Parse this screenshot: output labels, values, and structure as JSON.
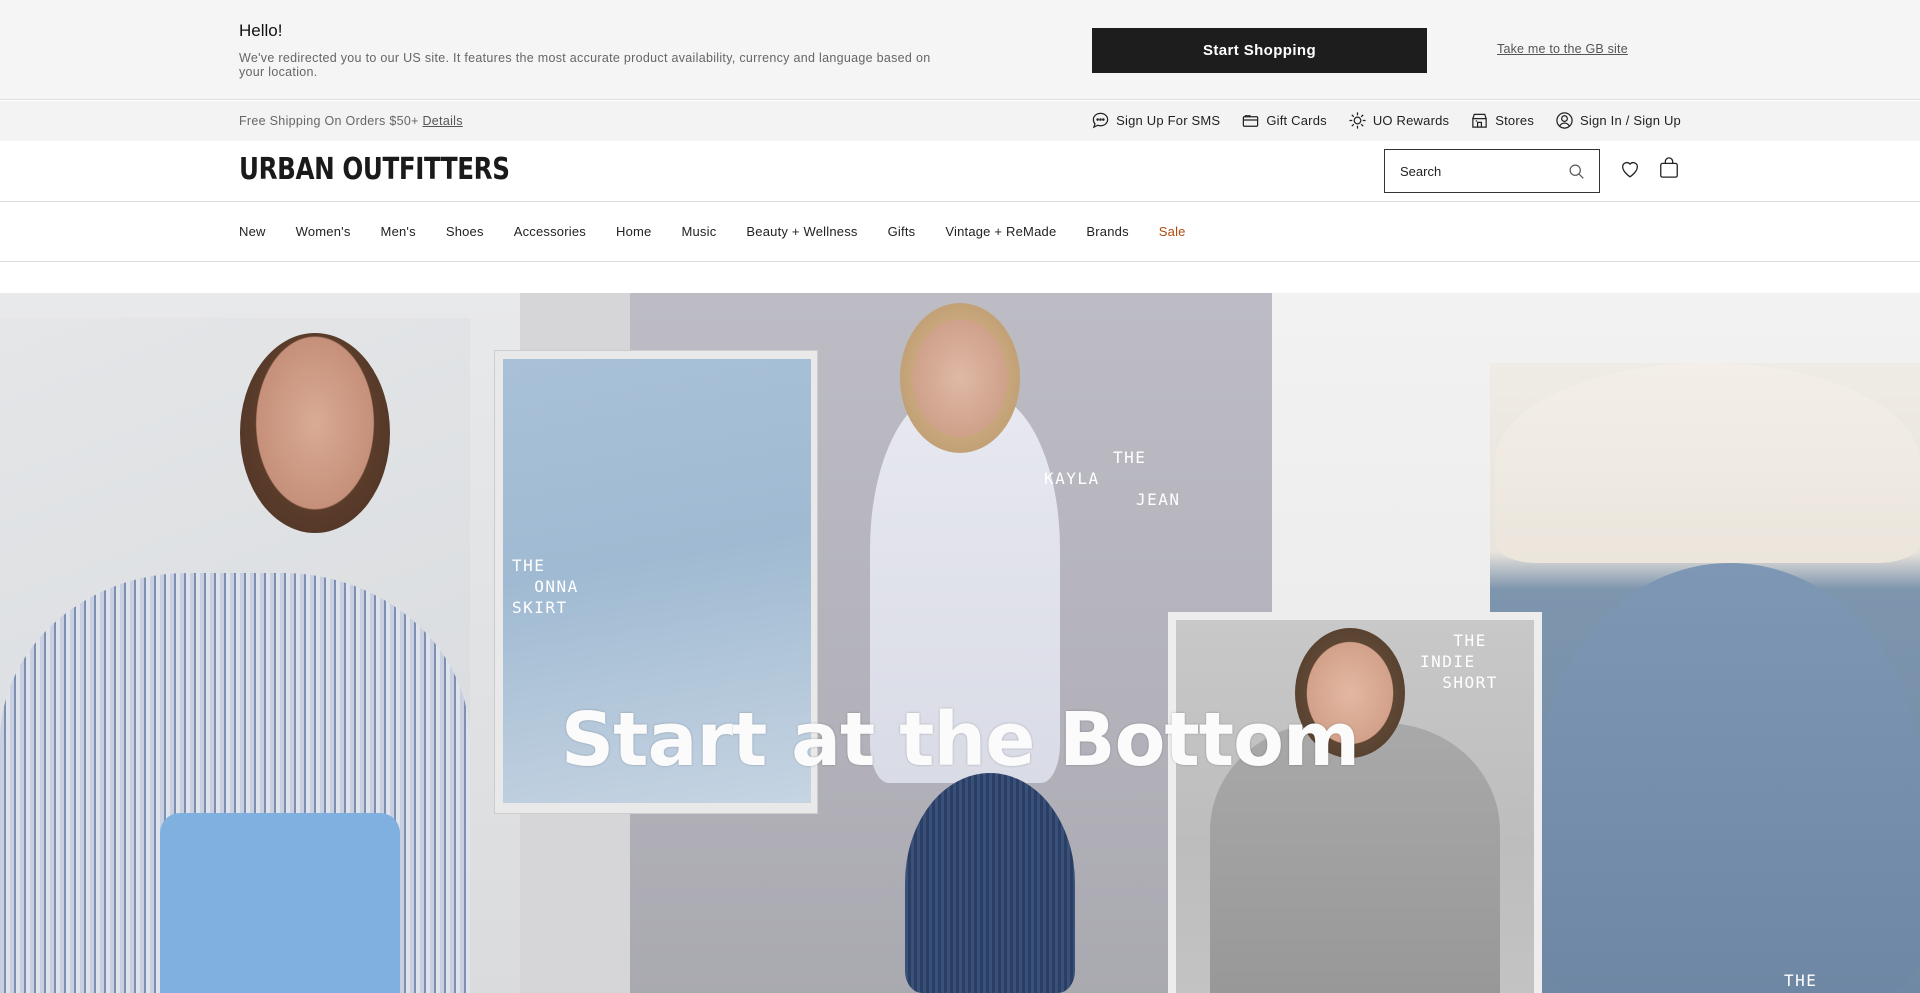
{
  "redirect_banner": {
    "greeting": "Hello!",
    "message": "We've redirected you to our US site. It features the most accurate product availability, currency and language based on your location.",
    "start_button": "Start Shopping",
    "gb_link": "Take me to the GB site"
  },
  "utility_bar": {
    "shipping_text": "Free Shipping On Orders $50+",
    "details_link": "Details",
    "links": [
      {
        "label": "Sign Up For SMS",
        "icon": "chat-bubble-icon"
      },
      {
        "label": "Gift Cards",
        "icon": "gift-card-icon"
      },
      {
        "label": "UO Rewards",
        "icon": "rewards-star-icon"
      },
      {
        "label": "Stores",
        "icon": "store-icon"
      },
      {
        "label": "Sign In / Sign Up",
        "icon": "user-icon"
      }
    ]
  },
  "header": {
    "logo": "URBAN OUTFITTERS",
    "search_placeholder": "Search"
  },
  "nav": {
    "items": [
      "New",
      "Women's",
      "Men's",
      "Shoes",
      "Accessories",
      "Home",
      "Music",
      "Beauty + Wellness",
      "Gifts",
      "Vintage + ReMade",
      "Brands",
      "Sale"
    ]
  },
  "hero": {
    "title": "Start at the Bottom",
    "labels": {
      "onna": "THE\n  ONNA\nSKIRT",
      "kayla_the": "THE",
      "kayla": "KAYLA",
      "kayla_jean": "JEAN",
      "indie": "   THE\nINDIE\n  SHORT",
      "bottom_the": "THE"
    }
  },
  "colors": {
    "primary_button": "#1d1d1d",
    "sale": "#b04a10",
    "banner_bg": "#f5f5f5"
  }
}
